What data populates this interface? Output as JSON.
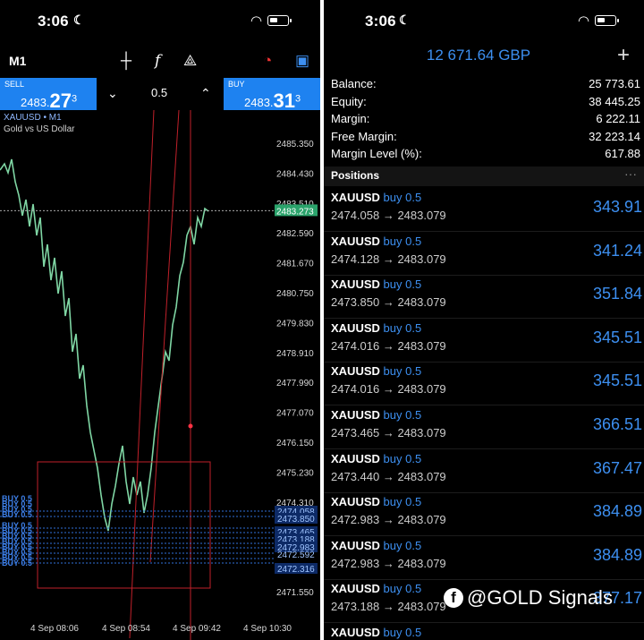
{
  "left": {
    "status": {
      "time": "3:06"
    },
    "toolbar": {
      "timeframe": "M1"
    },
    "trade": {
      "sell_label": "SELL",
      "sell_price_main": "2483.",
      "sell_price_big": "27",
      "sell_price_sup": "3",
      "buy_label": "BUY",
      "buy_price_main": "2483.",
      "buy_price_big": "31",
      "buy_price_sup": "3",
      "lot": "0.5"
    },
    "chart": {
      "symbol": "XAUUSD • M1",
      "description": "Gold vs US Dollar",
      "current_price": "2483.273",
      "partial_label": "2483.510",
      "price_ticks": [
        "2485.350",
        "2484.430",
        "2482.590",
        "2481.670",
        "2480.750",
        "2479.830",
        "2478.910",
        "2477.990",
        "2477.070",
        "2476.150",
        "2475.230",
        "2474.310",
        "2471.550"
      ],
      "time_ticks": [
        "4 Sep 08:06",
        "4 Sep 08:54",
        "4 Sep 09:42",
        "4 Sep 10:30"
      ],
      "entry_labels": [
        "2474.058",
        "2473.850",
        "2473.465",
        "2473.188",
        "2472.983",
        "2472.316"
      ],
      "entry_label_partial": "2472.592",
      "order_tag": "BUY 0.5"
    }
  },
  "right": {
    "status": {
      "time": "3:06"
    },
    "account": {
      "title": "12 671.64 GBP",
      "rows": [
        {
          "k": "Balance:",
          "v": "25 773.61"
        },
        {
          "k": "Equity:",
          "v": "38 445.25"
        },
        {
          "k": "Margin:",
          "v": "6 222.11"
        },
        {
          "k": "Free Margin:",
          "v": "32 223.14"
        },
        {
          "k": "Margin Level (%):",
          "v": "617.88"
        }
      ]
    },
    "positions_title": "Positions",
    "positions": [
      {
        "sym": "XAUUSD",
        "dir": "buy 0.5",
        "prices": "2474.058 → 2483.079",
        "pl": "343.91"
      },
      {
        "sym": "XAUUSD",
        "dir": "buy 0.5",
        "prices": "2474.128 → 2483.079",
        "pl": "341.24"
      },
      {
        "sym": "XAUUSD",
        "dir": "buy 0.5",
        "prices": "2473.850 → 2483.079",
        "pl": "351.84"
      },
      {
        "sym": "XAUUSD",
        "dir": "buy 0.5",
        "prices": "2474.016 → 2483.079",
        "pl": "345.51"
      },
      {
        "sym": "XAUUSD",
        "dir": "buy 0.5",
        "prices": "2474.016 → 2483.079",
        "pl": "345.51"
      },
      {
        "sym": "XAUUSD",
        "dir": "buy 0.5",
        "prices": "2473.465 → 2483.079",
        "pl": "366.51"
      },
      {
        "sym": "XAUUSD",
        "dir": "buy 0.5",
        "prices": "2473.440 → 2483.079",
        "pl": "367.47"
      },
      {
        "sym": "XAUUSD",
        "dir": "buy 0.5",
        "prices": "2472.983 → 2483.079",
        "pl": "384.89"
      },
      {
        "sym": "XAUUSD",
        "dir": "buy 0.5",
        "prices": "2472.983 → 2483.079",
        "pl": "384.89"
      },
      {
        "sym": "XAUUSD",
        "dir": "buy 0.5",
        "prices": "2473.188 → 2483.079",
        "pl": "377.17"
      },
      {
        "sym": "XAUUSD",
        "dir": "buy 0.5",
        "prices": "",
        "pl": ""
      }
    ]
  },
  "watermark": "@GOLD Signals",
  "colors": {
    "accent": "#1e82f0",
    "line": "#7fd6a4",
    "red": "#c0202a"
  }
}
